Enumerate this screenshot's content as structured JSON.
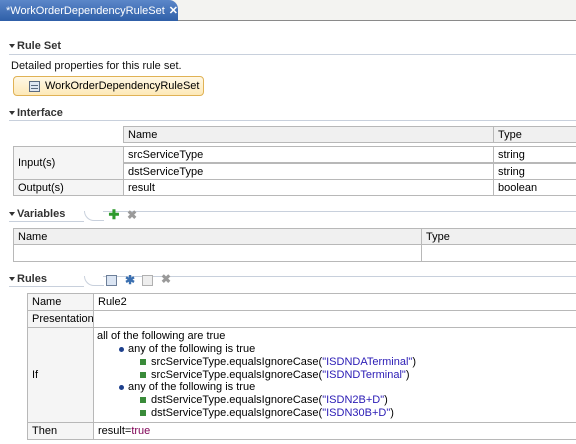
{
  "tab": {
    "title": "*WorkOrderDependencyRuleSet"
  },
  "rule_set": {
    "header": "Rule Set",
    "description": "Detailed properties for this rule set.",
    "button_label": "WorkOrderDependencyRuleSet"
  },
  "interface": {
    "header": "Interface",
    "columns": [
      "Name",
      "Type"
    ],
    "input_label": "Input(s)",
    "output_label": "Output(s)",
    "inputs": [
      {
        "name": "srcServiceType",
        "type": "string"
      },
      {
        "name": "dstServiceType",
        "type": "string"
      }
    ],
    "outputs": [
      {
        "name": "result",
        "type": "boolean"
      }
    ]
  },
  "variables": {
    "header": "Variables",
    "columns": [
      "Name",
      "Type"
    ]
  },
  "rules": {
    "header": "Rules",
    "labels": {
      "name": "Name",
      "presentation": "Presentation",
      "if": "If",
      "then": "Then"
    },
    "name_value": "Rule2",
    "presentation_value": "",
    "if_root": "all of the following are true",
    "group1_title": "any of the following is true",
    "group1_items": [
      {
        "expr": "srcServiceType.equalsIgnoreCase(",
        "arg": "\"ISDNDATerminal\"",
        "close": ")"
      },
      {
        "expr": "srcServiceType.equalsIgnoreCase(",
        "arg": "\"ISDNDTerminal\"",
        "close": ")"
      }
    ],
    "group2_title": "any of the following is true",
    "group2_items": [
      {
        "expr": "dstServiceType.equalsIgnoreCase(",
        "arg": "\"ISDN2B+D\"",
        "close": ")"
      },
      {
        "expr": "dstServiceType.equalsIgnoreCase(",
        "arg": "\"ISDN30B+D\"",
        "close": ")"
      }
    ],
    "then_prefix": "result=",
    "then_value": "true"
  },
  "icons": {
    "tab": "editor-icon",
    "close": "close-icon",
    "add": "plus-icon",
    "delete": "delete-icon"
  },
  "colors": {
    "tab_bg": "#2f5fa8",
    "section_line": "#c8d0dc",
    "string_literal": "#2a1bb5",
    "keyword": "#7f0055",
    "add_green": "#2d9a2d"
  }
}
